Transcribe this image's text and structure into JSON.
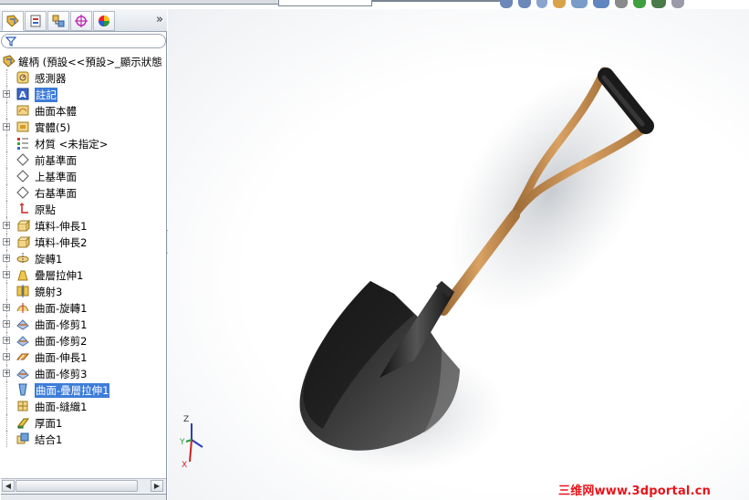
{
  "toolbar": {
    "tabs": [
      {
        "name": "feature-manager",
        "icon": "feature-manager-icon",
        "active": true
      },
      {
        "name": "property-manager",
        "icon": "property-manager-icon",
        "active": false
      },
      {
        "name": "configuration-manager",
        "icon": "configuration-manager-icon",
        "active": false
      },
      {
        "name": "dim-xpert-manager",
        "icon": "dimxpert-icon",
        "active": false
      },
      {
        "name": "display-manager",
        "icon": "display-manager-icon",
        "active": false
      }
    ],
    "more": "»"
  },
  "tree": {
    "root": "鏟柄 (預設<<預設>_顯示狀態",
    "items": [
      {
        "label": "感測器",
        "icon": "sensor-icon",
        "expandable": false
      },
      {
        "label": "註記",
        "icon": "annotations-icon",
        "expandable": true,
        "highlight": true
      },
      {
        "label": "曲面本體",
        "icon": "surface-bodies-icon",
        "expandable": false
      },
      {
        "label": "實體(5)",
        "icon": "solid-bodies-icon",
        "expandable": true
      },
      {
        "label": "材質 <未指定>",
        "icon": "material-icon",
        "expandable": false
      },
      {
        "label": "前基準面",
        "icon": "plane-icon",
        "expandable": false
      },
      {
        "label": "上基準面",
        "icon": "plane-icon",
        "expandable": false
      },
      {
        "label": "右基準面",
        "icon": "plane-icon",
        "expandable": false
      },
      {
        "label": "原點",
        "icon": "origin-icon",
        "expandable": false
      },
      {
        "label": "填料-伸長1",
        "icon": "extrude-boss-icon",
        "expandable": true
      },
      {
        "label": "填料-伸長2",
        "icon": "extrude-boss-icon",
        "expandable": true
      },
      {
        "label": "旋轉1",
        "icon": "revolve-icon",
        "expandable": true
      },
      {
        "label": "疊層拉伸1",
        "icon": "loft-icon",
        "expandable": true
      },
      {
        "label": "鏡射3",
        "icon": "mirror-icon",
        "expandable": false
      },
      {
        "label": "曲面-旋轉1",
        "icon": "surface-revolve-icon",
        "expandable": true
      },
      {
        "label": "曲面-修剪1",
        "icon": "surface-trim-icon",
        "expandable": true
      },
      {
        "label": "曲面-修剪2",
        "icon": "surface-trim-icon",
        "expandable": true
      },
      {
        "label": "曲面-伸長1",
        "icon": "surface-extrude-icon",
        "expandable": true
      },
      {
        "label": "曲面-修剪3",
        "icon": "surface-trim-icon",
        "expandable": true
      },
      {
        "label": "曲面-疊層拉伸1",
        "icon": "surface-loft-icon",
        "expandable": false,
        "highlight": true
      },
      {
        "label": "曲面-縫織1",
        "icon": "surface-knit-icon",
        "expandable": false
      },
      {
        "label": "厚面1",
        "icon": "thicken-icon",
        "expandable": false
      },
      {
        "label": "結合1",
        "icon": "combine-icon",
        "expandable": false
      }
    ]
  },
  "triad": {
    "x_label": "X",
    "y_label": "Y",
    "z_label": "Z"
  },
  "watermark": "三维网www.3dportal.cn",
  "colors": {
    "highlight": "#3d7cd9",
    "handle_wood": "#c68a4a",
    "blade": "#2a2a2a",
    "watermark": "#e8141b"
  }
}
